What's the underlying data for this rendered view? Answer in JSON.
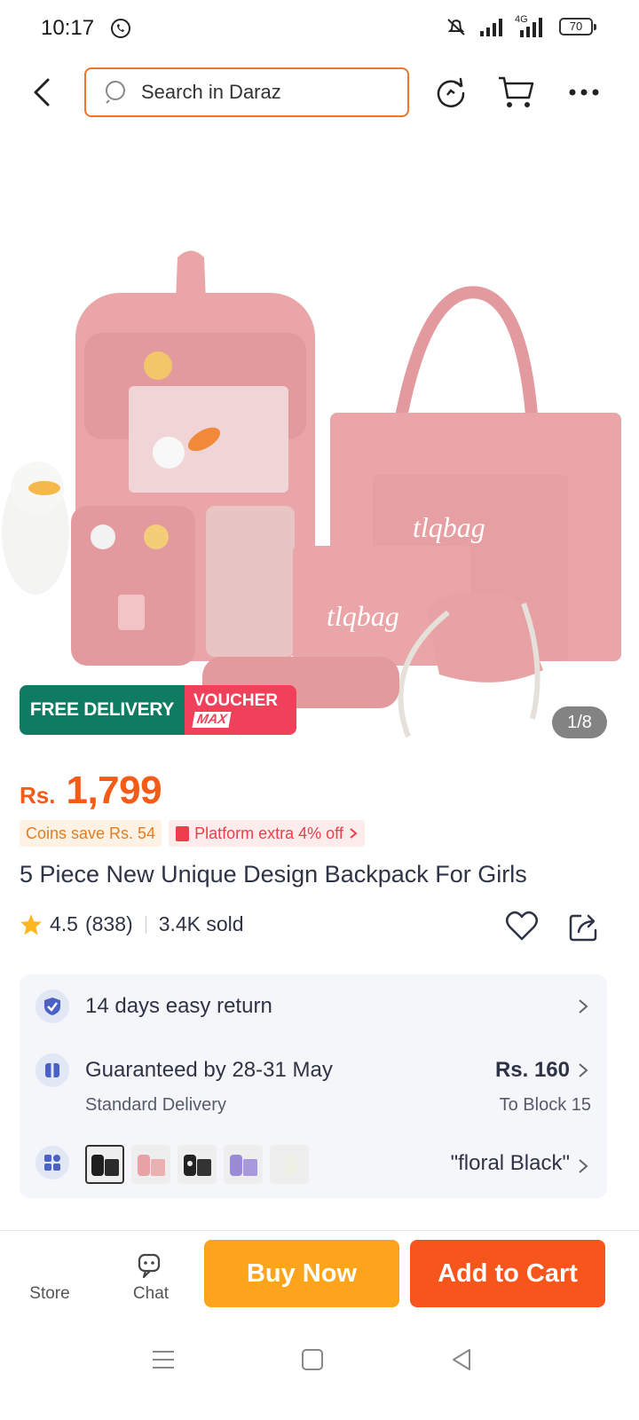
{
  "status_bar": {
    "time": "10:17",
    "network": "4G",
    "battery": "70"
  },
  "search": {
    "placeholder": "Search in Daraz"
  },
  "gallery": {
    "promo_free": "FREE DELIVERY",
    "promo_voucher_line1": "VOUCHER",
    "promo_voucher_line2": "MAX",
    "image_text_1": "tlqbag",
    "image_text_2": "tlqbag",
    "page_counter": "1/8"
  },
  "product": {
    "currency": "Rs.",
    "price": "1,799",
    "coins_tag": "Coins save Rs. 54",
    "platform_tag": "Platform extra 4% off",
    "title": "5 Piece New Unique Design Backpack For Girls",
    "rating": "4.5",
    "rating_count": "(838)",
    "sold": "3.4K sold"
  },
  "services": {
    "return_text": "14 days easy return",
    "delivery_text": "Guaranteed by 28-31 May",
    "delivery_sub": "Standard Delivery",
    "delivery_price": "Rs. 160",
    "delivery_location": "To Block 15",
    "variant_selected": "\"floral Black\""
  },
  "bottom_bar": {
    "store_label": "Store",
    "chat_label": "Chat",
    "buy_now_label": "Buy Now",
    "add_to_cart_label": "Add to Cart"
  },
  "colors": {
    "accent_orange": "#f6551c",
    "buy_now_yellow": "#fca41c",
    "price_orange": "#f55a16",
    "free_delivery_green": "#0e7b62",
    "voucher_red": "#f0415a",
    "product_pink": "#e8a1a4"
  }
}
